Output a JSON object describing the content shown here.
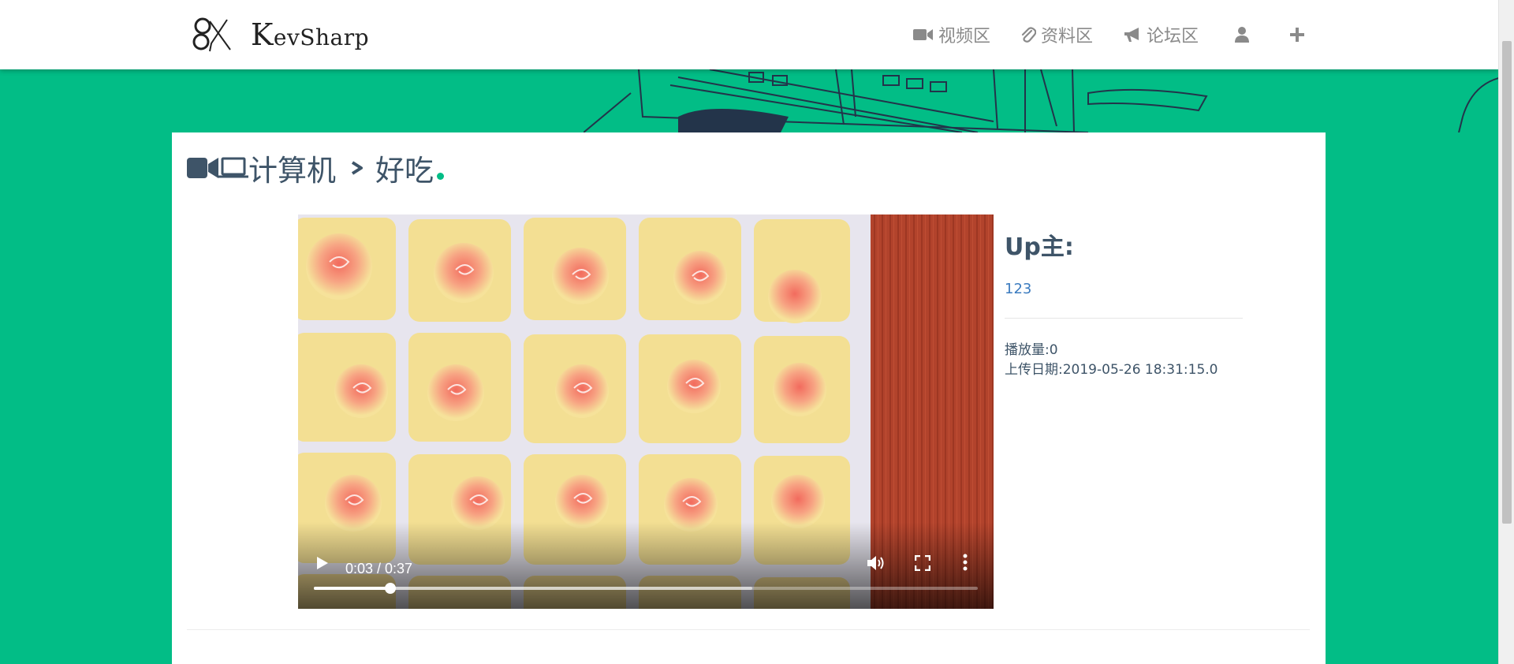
{
  "brand": {
    "name": "KevSharp"
  },
  "nav": {
    "items": [
      {
        "label": "视频区",
        "icon": "video-camera-icon"
      },
      {
        "label": "资料区",
        "icon": "paperclip-icon"
      },
      {
        "label": "论坛区",
        "icon": "megaphone-icon"
      }
    ],
    "user_icon": "user-icon",
    "add_icon": "plus-icon"
  },
  "breadcrumb": {
    "category": "计算机",
    "title": "好吃"
  },
  "video": {
    "time_display": "0:03 / 0:37",
    "played_fraction": 0.115,
    "buffered_fraction": 0.66
  },
  "uploader": {
    "label": "Up主:",
    "name": "123",
    "views": "播放量:0",
    "upload_date": "上传日期:2019-05-26 18:31:15.0"
  },
  "colors": {
    "accent": "#02bd86",
    "text": "#3e5468",
    "link": "#3b7bbf"
  }
}
